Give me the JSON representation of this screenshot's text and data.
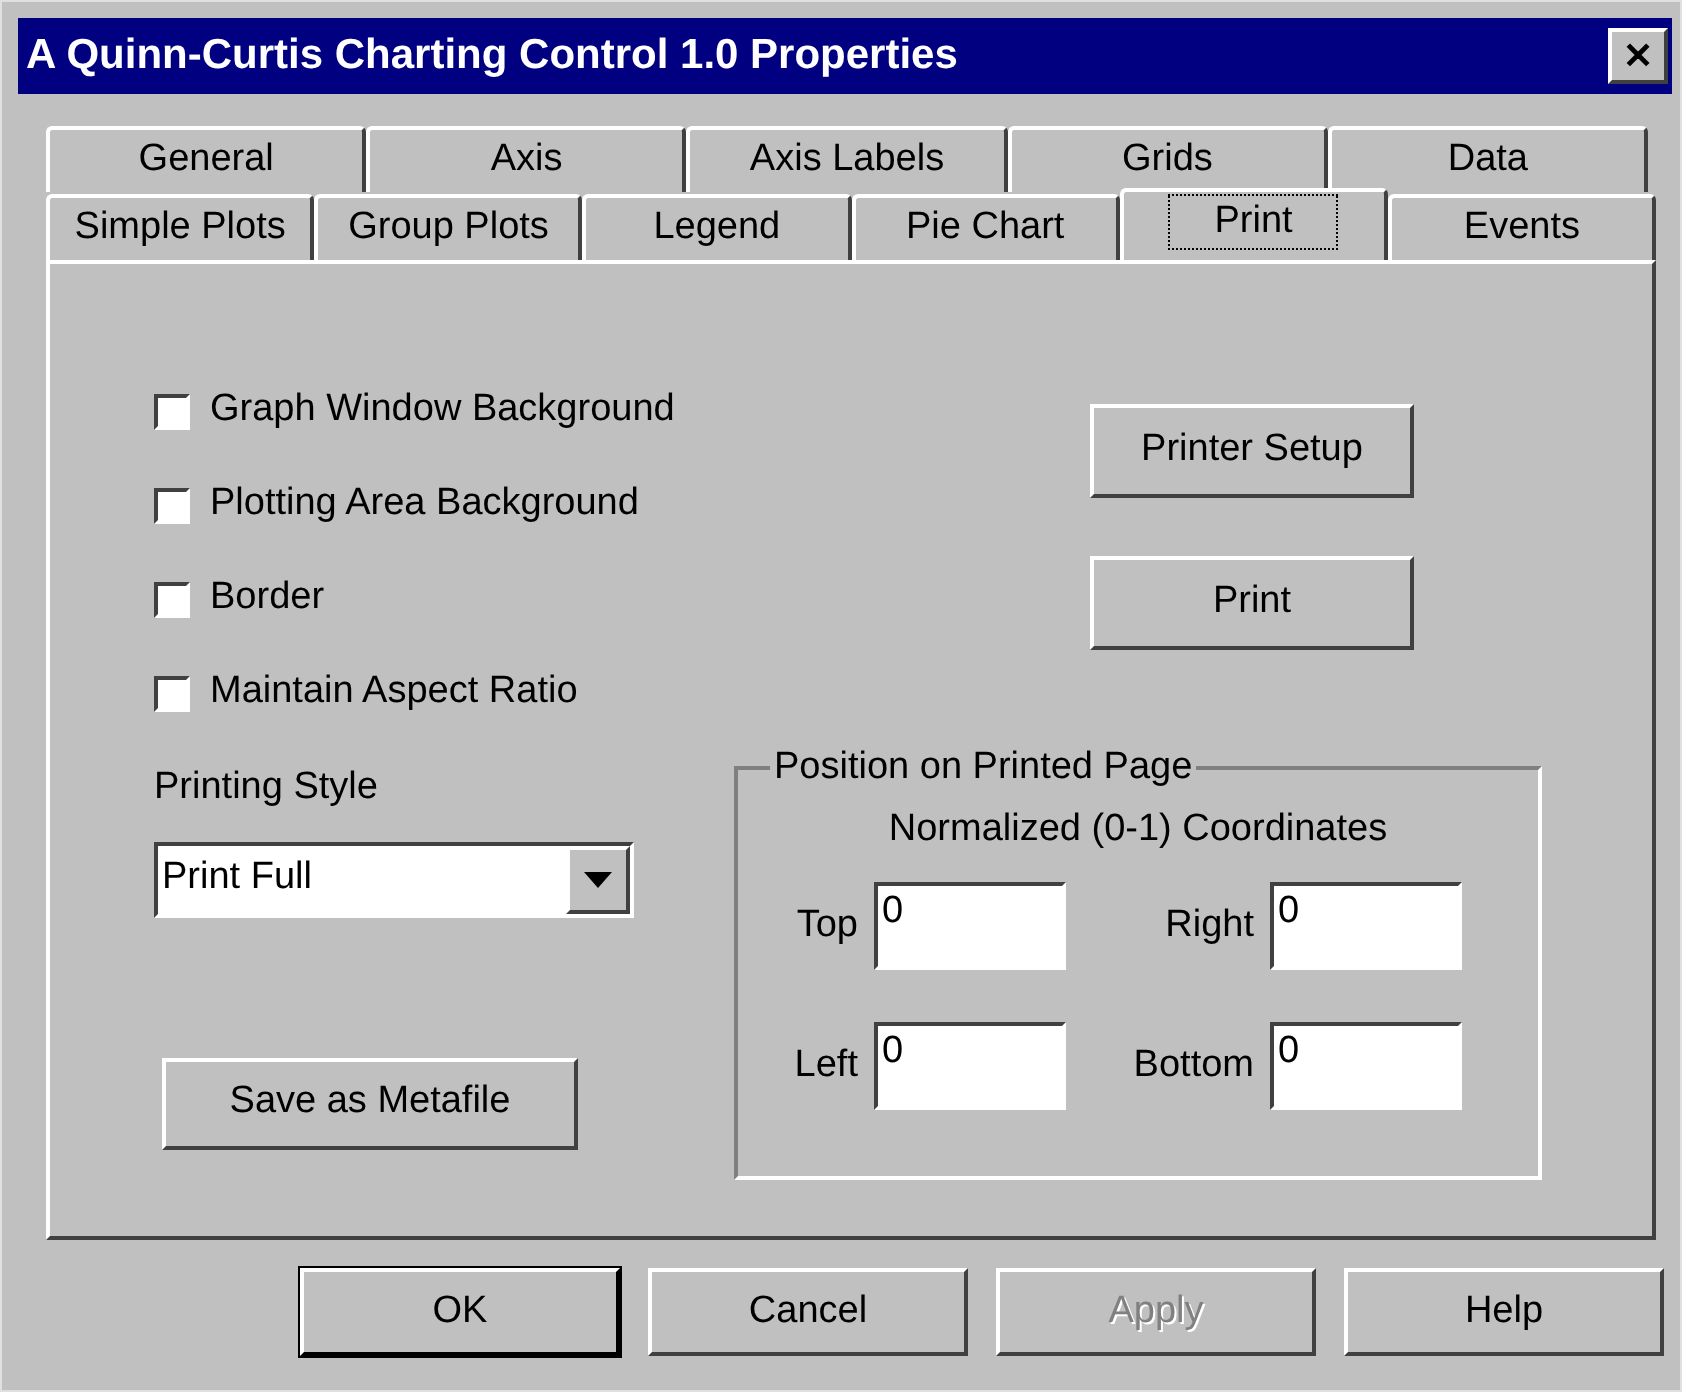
{
  "window": {
    "title": "A Quinn-Curtis Charting Control 1.0 Properties",
    "close": "✕"
  },
  "tab_rows": [
    {
      "tabs": [
        {
          "label": "General",
          "selected": false
        },
        {
          "label": "Axis",
          "selected": false
        },
        {
          "label": "Axis Labels",
          "selected": false
        },
        {
          "label": "Grids",
          "selected": false
        },
        {
          "label": "Data",
          "selected": false
        }
      ]
    },
    {
      "tabs": [
        {
          "label": "Simple Plots",
          "selected": false
        },
        {
          "label": "Group Plots",
          "selected": false
        },
        {
          "label": "Legend",
          "selected": false
        },
        {
          "label": "Pie Chart",
          "selected": false
        },
        {
          "label": "Print",
          "selected": true
        },
        {
          "label": "Events",
          "selected": false
        }
      ]
    }
  ],
  "checkboxes": [
    {
      "label": "Graph Window Background",
      "checked": false
    },
    {
      "label": "Plotting Area Background",
      "checked": false
    },
    {
      "label": "Border",
      "checked": false
    },
    {
      "label": "Maintain Aspect Ratio",
      "checked": false
    }
  ],
  "printing_style": {
    "label": "Printing Style",
    "value": "Print Full"
  },
  "save_button": "Save as Metafile",
  "action_buttons": [
    "Printer Setup",
    "Print"
  ],
  "position_group": {
    "title": "Position on Printed Page",
    "subtitle": "Normalized (0-1) Coordinates",
    "fields": [
      {
        "label": "Top",
        "value": "0"
      },
      {
        "label": "Right",
        "value": "0"
      },
      {
        "label": "Left",
        "value": "0"
      },
      {
        "label": "Bottom",
        "value": "0"
      }
    ]
  },
  "buttons": [
    {
      "label": "OK",
      "default": true,
      "disabled": false
    },
    {
      "label": "Cancel",
      "default": false,
      "disabled": false
    },
    {
      "label": "Apply",
      "default": false,
      "disabled": true
    },
    {
      "label": "Help",
      "default": false,
      "disabled": false
    }
  ]
}
